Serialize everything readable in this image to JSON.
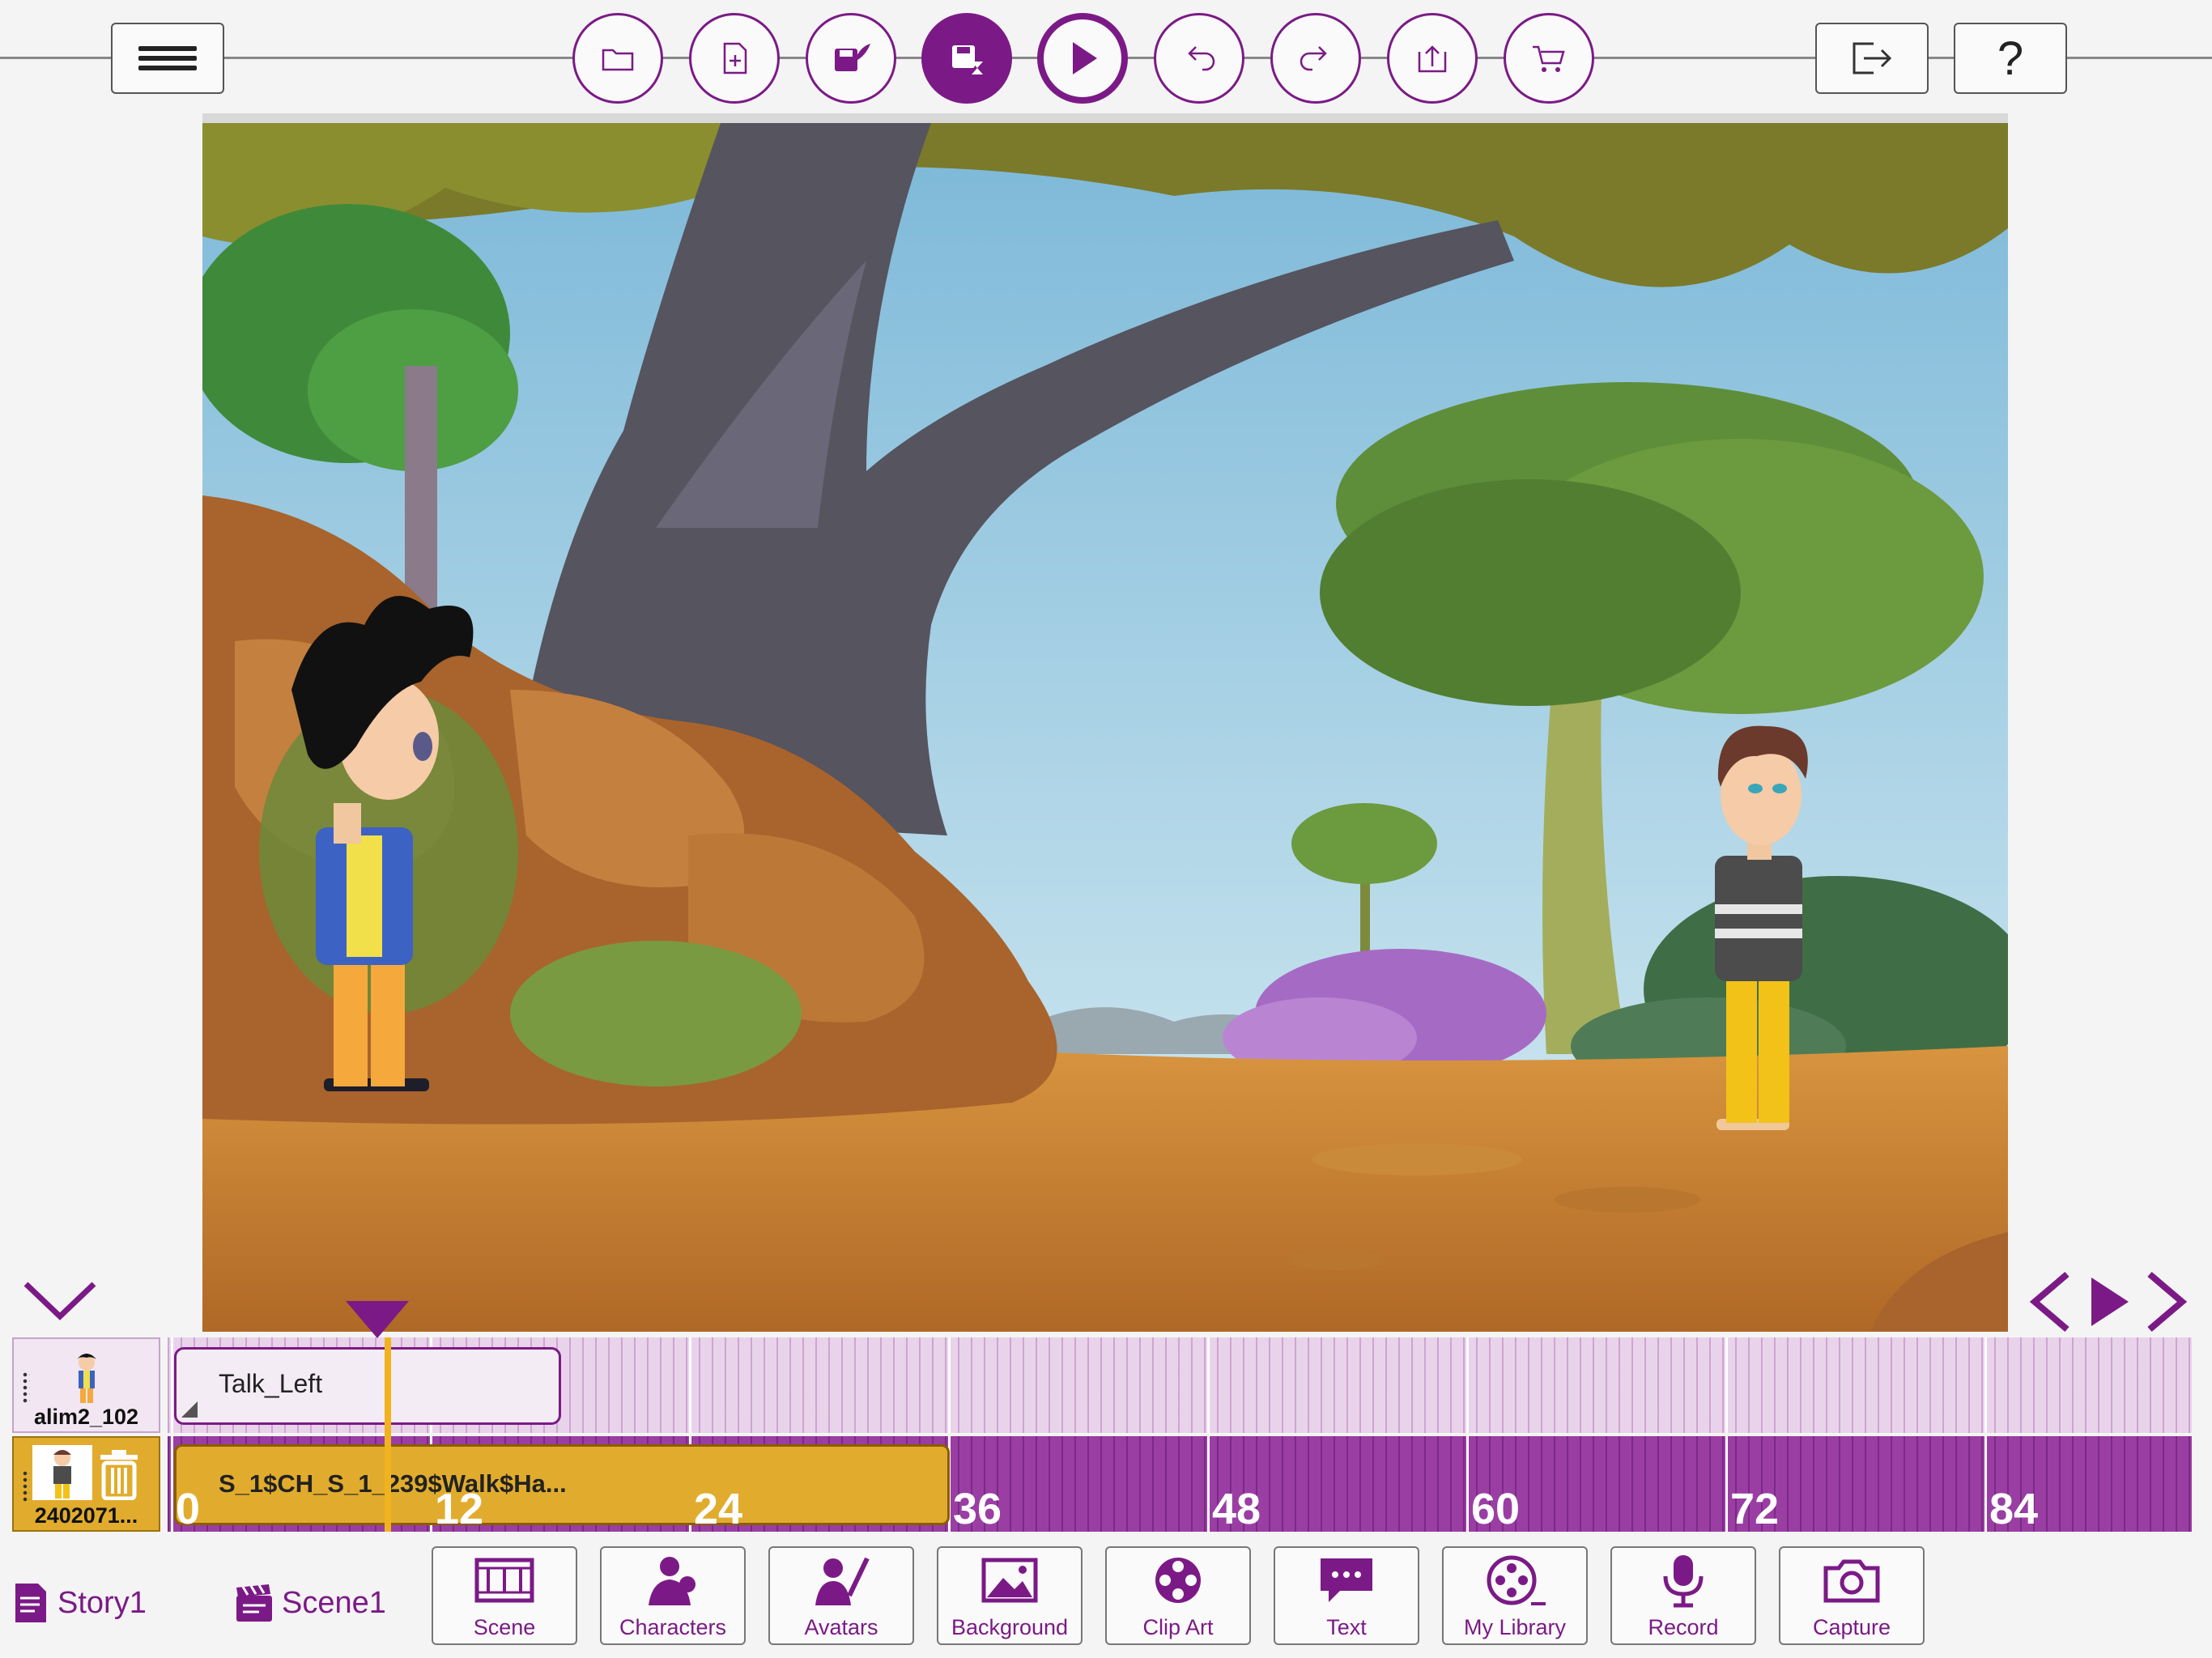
{
  "toolbar": {
    "icons": [
      "menu-icon",
      "open-folder-icon",
      "new-file-icon",
      "save-as-icon",
      "save-progress-icon",
      "play-icon",
      "undo-icon",
      "redo-icon",
      "upload-icon",
      "cart-icon",
      "exit-icon",
      "help-icon"
    ],
    "help_label": "?"
  },
  "colors": {
    "accent": "#7b1a86",
    "accent_light": "#e5cce6",
    "selected_track": "#e1ac2d"
  },
  "timeline": {
    "tracks": [
      {
        "name": "alim2_102",
        "clip": "Talk_Left"
      },
      {
        "name": "2402071...",
        "clip": "S_1$CH_S_1_239$Walk$Ha..."
      }
    ],
    "ruler": [
      "0",
      "12",
      "24",
      "36",
      "48",
      "60",
      "72",
      "84"
    ]
  },
  "breadcrumb": {
    "story": "Story1",
    "scene": "Scene1"
  },
  "categories": [
    "Scene",
    "Characters",
    "Avatars",
    "Background",
    "Clip Art",
    "Text",
    "My Library",
    "Record",
    "Capture"
  ]
}
